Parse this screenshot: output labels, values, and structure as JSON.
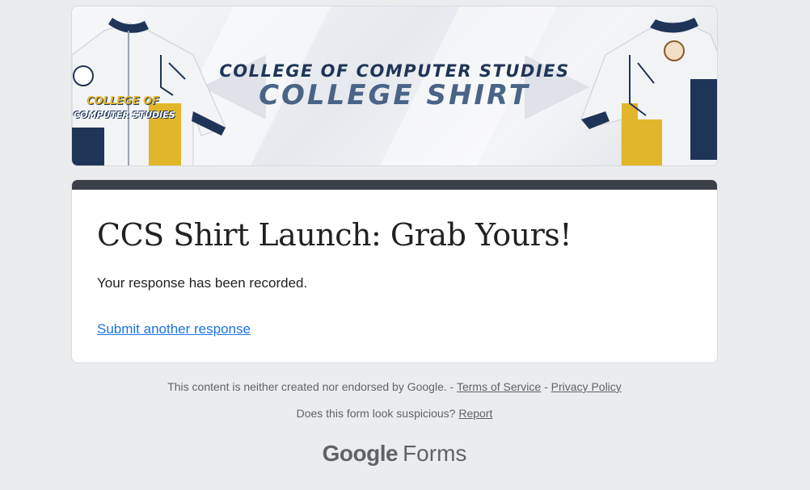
{
  "banner": {
    "line1": "COLLEGE OF COMPUTER STUDIES",
    "line2": "COLLEGE SHIRT",
    "shirt_text_line1": "COLLEGE OF",
    "shirt_text_line2": "COMPUTER STUDIES"
  },
  "form": {
    "title": "CCS Shirt Launch: Grab Yours!",
    "confirmation": "Your response has been recorded.",
    "submit_another": "Submit another response"
  },
  "footer": {
    "disclaimer": "This content is neither created nor endorsed by Google.",
    "separator1": " - ",
    "terms": "Terms of Service",
    "separator2": " - ",
    "privacy": "Privacy Policy",
    "suspicious": "Does this form look suspicious?",
    "report": "Report",
    "logo_google": "Google",
    "logo_forms": "Forms"
  },
  "colors": {
    "accent_bar": "#3b3f47",
    "link": "#1a73e8",
    "background": "#ebecee"
  }
}
